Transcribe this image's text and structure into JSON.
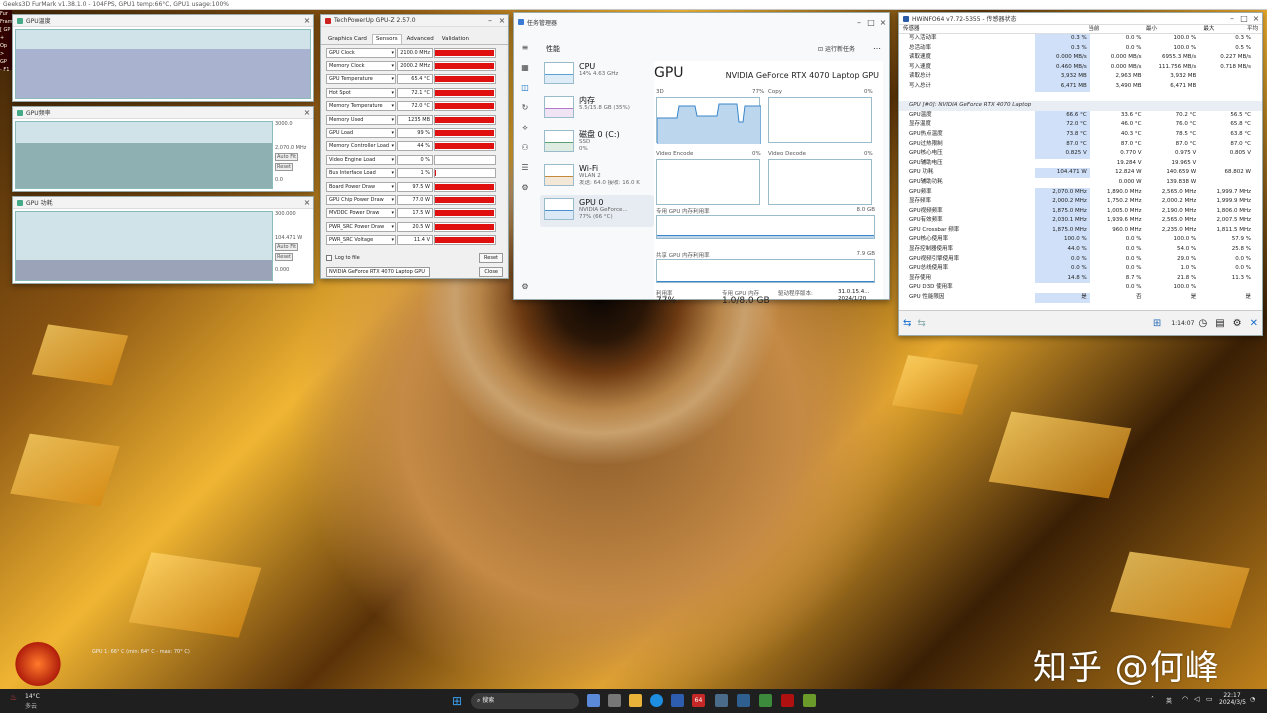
{
  "desktop": {
    "watermark": "知乎 @何峰",
    "osd": "GPU 1: 66° C (min: 64° C - max: 70° C)"
  },
  "furmark": {
    "title": "Geeks3D FurMark v1.38.1.0 - 104FPS, GPU1 temp:66°C, GPU1 usage:100%",
    "overlay": [
      "Fur",
      "Fram",
      "[ GP",
      "+ Op",
      "> GP",
      "- F1"
    ]
  },
  "graphs": [
    {
      "title": "GPU温度",
      "labels": [],
      "buttons": []
    },
    {
      "title": "GPU频率",
      "labels": [
        "3000.0",
        "2,070.0 MHz",
        "0.0"
      ],
      "buttons": [
        "Auto Fit",
        "Reset"
      ]
    },
    {
      "title": "GPU 功耗",
      "labels": [
        "300.000",
        "104.471 W",
        "0.000"
      ],
      "buttons": [
        "Auto Fit",
        "Reset"
      ]
    }
  ],
  "gpuz": {
    "title": "TechPowerUp GPU-Z 2.57.0",
    "tabs": [
      "Graphics Card",
      "Sensors",
      "Advanced",
      "Validation"
    ],
    "active_tab": "Sensors",
    "rows": [
      {
        "name": "GPU Clock",
        "value": "2100.0 MHz",
        "level": 0.98
      },
      {
        "name": "Memory Clock",
        "value": "2000.2 MHz",
        "level": 0.98
      },
      {
        "name": "GPU Temperature",
        "value": "65.4 °C",
        "level": 0.98
      },
      {
        "name": "Hot Spot",
        "value": "72.1 °C",
        "level": 0.98
      },
      {
        "name": "Memory Temperature",
        "value": "72.0 °C",
        "level": 0.98
      },
      {
        "name": "Memory Used",
        "value": "1235 MB",
        "level": 0.98
      },
      {
        "name": "GPU Load",
        "value": "99 %",
        "level": 0.98
      },
      {
        "name": "Memory Controller Load",
        "value": "44 %",
        "level": 0.98
      },
      {
        "name": "Video Engine Load",
        "value": "0 %",
        "level": 0
      },
      {
        "name": "Bus Interface Load",
        "value": "1 %",
        "level": 0.02
      },
      {
        "name": "Board Power Draw",
        "value": "97.5 W",
        "level": 0.98
      },
      {
        "name": "GPU Chip Power Draw",
        "value": "77.0 W",
        "level": 0.98
      },
      {
        "name": "MVDDC Power Draw",
        "value": "17.5 W",
        "level": 0.98
      },
      {
        "name": "PWR_SRC Power Draw",
        "value": "20.5 W",
        "level": 0.98
      },
      {
        "name": "PWR_SRC Voltage",
        "value": "11.4 V",
        "level": 0.98
      }
    ],
    "log_label": "Log to file",
    "reset": "Reset",
    "device": "NVIDIA GeForce RTX 4070 Laptop GPU",
    "close": "Close"
  },
  "taskmgr": {
    "title": "任务管理器",
    "section": "性能",
    "run_task": "运行新任务",
    "more": "…",
    "items": [
      {
        "name": "CPU",
        "sub1": "14% 4.63 GHz",
        "sub2": ""
      },
      {
        "name": "内存",
        "sub1": "5.5/15.8 GB (35%)",
        "sub2": ""
      },
      {
        "name": "磁盘 0 (C:)",
        "sub1": "SSD",
        "sub2": "0%"
      },
      {
        "name": "Wi-Fi",
        "sub1": "WLAN 2",
        "sub2": "发送: 64.0  接收: 16.0 K"
      },
      {
        "name": "GPU 0",
        "sub1": "NVIDIA GeForce...",
        "sub2": "77% (66 °C)"
      }
    ],
    "gpu": {
      "heading": "GPU",
      "model": "NVIDIA GeForce RTX 4070 Laptop GPU",
      "engines": [
        {
          "name": "3D",
          "pct": "77%"
        },
        {
          "name": "Copy",
          "pct": "0%"
        },
        {
          "name": "Video Encode",
          "pct": "0%"
        },
        {
          "name": "Video Decode",
          "pct": "0%"
        }
      ],
      "dedicated": {
        "label": "专用 GPU 内存利用率",
        "max": "8.0 GB"
      },
      "shared": {
        "label": "共享 GPU 内存利用率",
        "max": "7.9 GB"
      },
      "stats": [
        "利用率",
        "专用 GPU 内存",
        "驱动程序版本:",
        "31.0.15.4..."
      ],
      "stat_values": [
        "77%",
        "1.0/8.0 GB",
        "2024/1/20"
      ]
    }
  },
  "hwinfo": {
    "title": "HWiNFO64 v7.72-5355 - 传感器状态",
    "columns": [
      "传感器",
      "当前",
      "最小",
      "最大",
      "平均"
    ],
    "rows": [
      {
        "n": "写入活动率",
        "v": [
          "0.3 %",
          "0.0 %",
          "100.0 %",
          "0.3 %"
        ]
      },
      {
        "n": "总活动率",
        "v": [
          "0.3 %",
          "0.0 %",
          "100.0 %",
          "0.5 %"
        ]
      },
      {
        "n": "读取速度",
        "v": [
          "0.000 MB/s",
          "0.000 MB/s",
          "6955.3 MB/s",
          "0.227 MB/s"
        ]
      },
      {
        "n": "写入速度",
        "v": [
          "0.460 MB/s",
          "0.000 MB/s",
          "111.756 MB/s",
          "0.718 MB/s"
        ]
      },
      {
        "n": "读取总计",
        "v": [
          "3,932 MB",
          "2,963 MB",
          "3,932 MB",
          ""
        ]
      },
      {
        "n": "写入总计",
        "v": [
          "6,471 MB",
          "3,490 MB",
          "6,471 MB",
          ""
        ]
      },
      {
        "n": "",
        "v": [
          "",
          "",
          "",
          ""
        ]
      },
      {
        "n": "GPU [#0]: NVIDIA GeForce RTX 4070 Laptop",
        "v": [
          "",
          "",
          "",
          ""
        ],
        "sec": true
      },
      {
        "n": "GPU温度",
        "v": [
          "66.6 °C",
          "33.6 °C",
          "70.2 °C",
          "56.5 °C"
        ]
      },
      {
        "n": "显存温度",
        "v": [
          "72.0 °C",
          "46.0 °C",
          "76.0 °C",
          "65.8 °C"
        ]
      },
      {
        "n": "GPU热点温度",
        "v": [
          "73.8 °C",
          "40.3 °C",
          "78.5 °C",
          "63.8 °C"
        ]
      },
      {
        "n": "GPU过热限制",
        "v": [
          "87.0 °C",
          "87.0 °C",
          "87.0 °C",
          "87.0 °C"
        ]
      },
      {
        "n": "GPU核心电压",
        "v": [
          "0.825 V",
          "0.770 V",
          "0.975 V",
          "0.805 V"
        ]
      },
      {
        "n": "GPU辅助电压",
        "v": [
          "",
          "19.284 V",
          "19.965 V",
          ""
        ]
      },
      {
        "n": "GPU 功耗",
        "v": [
          "104.471 W",
          "12.824 W",
          "140.659 W",
          "68.802 W"
        ]
      },
      {
        "n": "GPU辅助功耗",
        "v": [
          "",
          "0.000 W",
          "139.838 W",
          ""
        ]
      },
      {
        "n": "GPU频率",
        "v": [
          "2,070.0 MHz",
          "1,890.0 MHz",
          "2,565.0 MHz",
          "1,999.7 MHz"
        ]
      },
      {
        "n": "显存频率",
        "v": [
          "2,000.2 MHz",
          "1,750.2 MHz",
          "2,000.2 MHz",
          "1,999.9 MHz"
        ]
      },
      {
        "n": "GPU视频频率",
        "v": [
          "1,875.0 MHz",
          "1,005.0 MHz",
          "2,190.0 MHz",
          "1,806.0 MHz"
        ]
      },
      {
        "n": "GPU有效频率",
        "v": [
          "2,030.1 MHz",
          "1,939.6 MHz",
          "2,565.0 MHz",
          "2,007.5 MHz"
        ]
      },
      {
        "n": "GPU Crossbar 频率",
        "v": [
          "1,875.0 MHz",
          "960.0 MHz",
          "2,235.0 MHz",
          "1,811.5 MHz"
        ]
      },
      {
        "n": "GPU核心使用率",
        "v": [
          "100.0 %",
          "0.0 %",
          "100.0 %",
          "57.9 %"
        ]
      },
      {
        "n": "显存控制器使用率",
        "v": [
          "44.0 %",
          "0.0 %",
          "54.0 %",
          "25.8 %"
        ]
      },
      {
        "n": "GPU视频引擎使用率",
        "v": [
          "0.0 %",
          "0.0 %",
          "29.0 %",
          "0.0 %"
        ]
      },
      {
        "n": "GPU总线使用率",
        "v": [
          "0.0 %",
          "0.0 %",
          "1.0 %",
          "0.0 %"
        ]
      },
      {
        "n": "显存使用",
        "v": [
          "14.8 %",
          "8.7 %",
          "21.8 %",
          "11.3 %"
        ]
      },
      {
        "n": "GPU D3D 使用率",
        "v": [
          "",
          "0.0 %",
          "100.0 %",
          ""
        ]
      },
      {
        "n": "GPU 性能限因",
        "v": [
          "是",
          "否",
          "是",
          "是"
        ]
      }
    ],
    "timer": "1:14:07"
  },
  "taskbar": {
    "weather": "14°C",
    "weather_sub": "多云",
    "search": "搜索",
    "app_badge": "64",
    "ime": "英",
    "time": "22:17",
    "date": "2024/3/5"
  },
  "colors": {
    "accent": "#0067c0",
    "gpuz_bar": "#e01010",
    "graph_bg": "#cfe3e9",
    "hw_highlight": "#cfe0f8"
  }
}
